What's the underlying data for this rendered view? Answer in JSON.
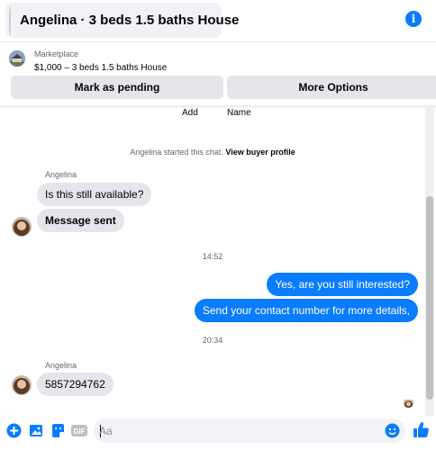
{
  "header": {
    "title": "Angelina · 3 beds 1.5 baths House",
    "info_icon": "info-icon",
    "accent_color": "#0a7cff"
  },
  "listing": {
    "kind": "Marketplace",
    "summary": "$1,000 – 3 beds 1.5 baths House",
    "buttons": {
      "mark_pending": "Mark as pending",
      "more_options": "More Options"
    }
  },
  "chat": {
    "add_label": "Add",
    "name_label": "Name",
    "started": {
      "text": "Angelina started this chat.",
      "link": "View buyer profile"
    },
    "messages": [
      {
        "sender": "Angelina",
        "text": "Is this still available?",
        "direction": "incoming"
      },
      {
        "text": "Message sent",
        "direction": "incoming"
      },
      {
        "timestamp": "14:52"
      },
      {
        "text": "Yes, are you still interested?",
        "direction": "outgoing"
      },
      {
        "text": "Send your contact number for more details,",
        "direction": "outgoing"
      },
      {
        "timestamp": "20:34"
      },
      {
        "sender": "Angelina",
        "text": "5857294762",
        "direction": "incoming"
      }
    ]
  },
  "composer": {
    "placeholder": "Aa",
    "icons": [
      "plus-circle-icon",
      "photo-icon",
      "sticker-icon",
      "gif-icon",
      "emoji-icon",
      "thumbs-up-icon"
    ]
  }
}
